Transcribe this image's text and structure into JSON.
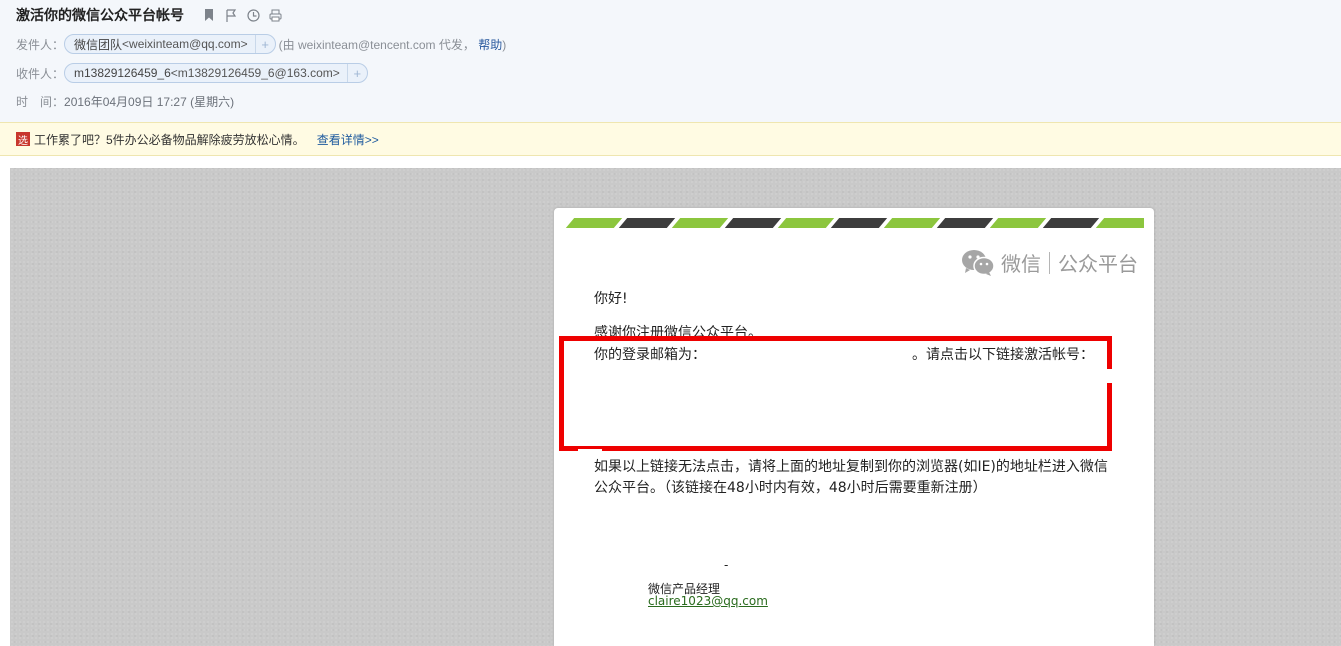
{
  "header": {
    "subject": "激活你的微信公众平台帐号",
    "icons": [
      "bookmark-icon",
      "flag-icon",
      "clock-icon",
      "print-icon"
    ],
    "from_label": "发件人：",
    "from_name": "微信团队",
    "from_addr": "<weixinteam@qq.com>",
    "plus": "+",
    "via_text": "(由 weixinteam@tencent.com 代发，",
    "help_link": "帮助",
    "via_close": ")",
    "to_label": "收件人：",
    "to_name": "m13829126459_6",
    "to_addr": "<m13829126459_6@163.com>",
    "time_label": "时　间：",
    "time_value": "2016年04月09日 17:27 (星期六)"
  },
  "banner": {
    "icon_text": "选",
    "text": "工作累了吧？5件办公必备物品解除疲劳放松心情。",
    "link": "查看详情>>"
  },
  "email": {
    "logo_main": "微信",
    "logo_sub": "公众平台",
    "greeting": "你好!",
    "thanks": "感谢你注册微信公众平台。",
    "login_label": "你的登录邮箱为：",
    "login_tail": "。请点击以下链接激活帐号：",
    "fallback_line1": "如果以上链接无法点击，请将上面的地址复制到你的浏览器(如IE)的地址栏进入微信",
    "fallback_line2": "公众平台。（该链接在48小时内有效，48小时后需要重新注册）",
    "dash": "-",
    "sig_title": "微信产品经理",
    "sig_email": "claire1023@qq.com"
  },
  "colors": {
    "stripe_green": "#8cc63e",
    "stripe_dark": "#3d3d3d",
    "highlight_red": "#ee0000",
    "link_blue": "#1e5a9e"
  }
}
